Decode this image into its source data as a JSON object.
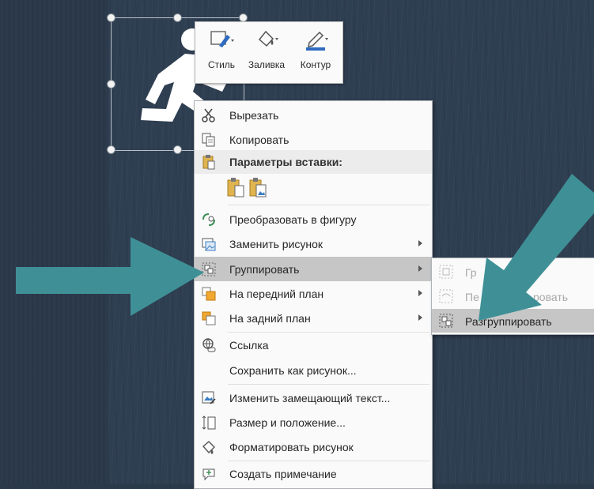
{
  "mini_toolbar": {
    "buttons": [
      {
        "label": "Стиль",
        "icon": "shape-style-icon"
      },
      {
        "label": "Заливка",
        "icon": "fill-bucket-icon"
      },
      {
        "label": "Контур",
        "icon": "outline-pen-icon"
      }
    ]
  },
  "context_menu": {
    "cut": "Вырезать",
    "copy": "Копировать",
    "paste_header": "Параметры вставки:",
    "convert_to_shape": "Преобразовать в фигуру",
    "change_picture": "Заменить рисунок",
    "group": "Группировать",
    "bring_forward": "На передний план",
    "send_backward": "На задний план",
    "link": "Ссылка",
    "save_as_picture": "Сохранить как рисунок...",
    "edit_alt_text": "Изменить замещающий текст...",
    "size_position": "Размер и положение...",
    "format_picture": "Форматировать рисунок",
    "new_comment": "Создать примечание"
  },
  "group_submenu": {
    "group": "Гр",
    "regroup": "Пе",
    "regroup_tail": "ровать",
    "ungroup": "Разгруппировать"
  },
  "colors": {
    "accent_arrow": "#3f9096",
    "highlight": "#c6c6c6",
    "outline_blue": "#2e6bc0"
  }
}
